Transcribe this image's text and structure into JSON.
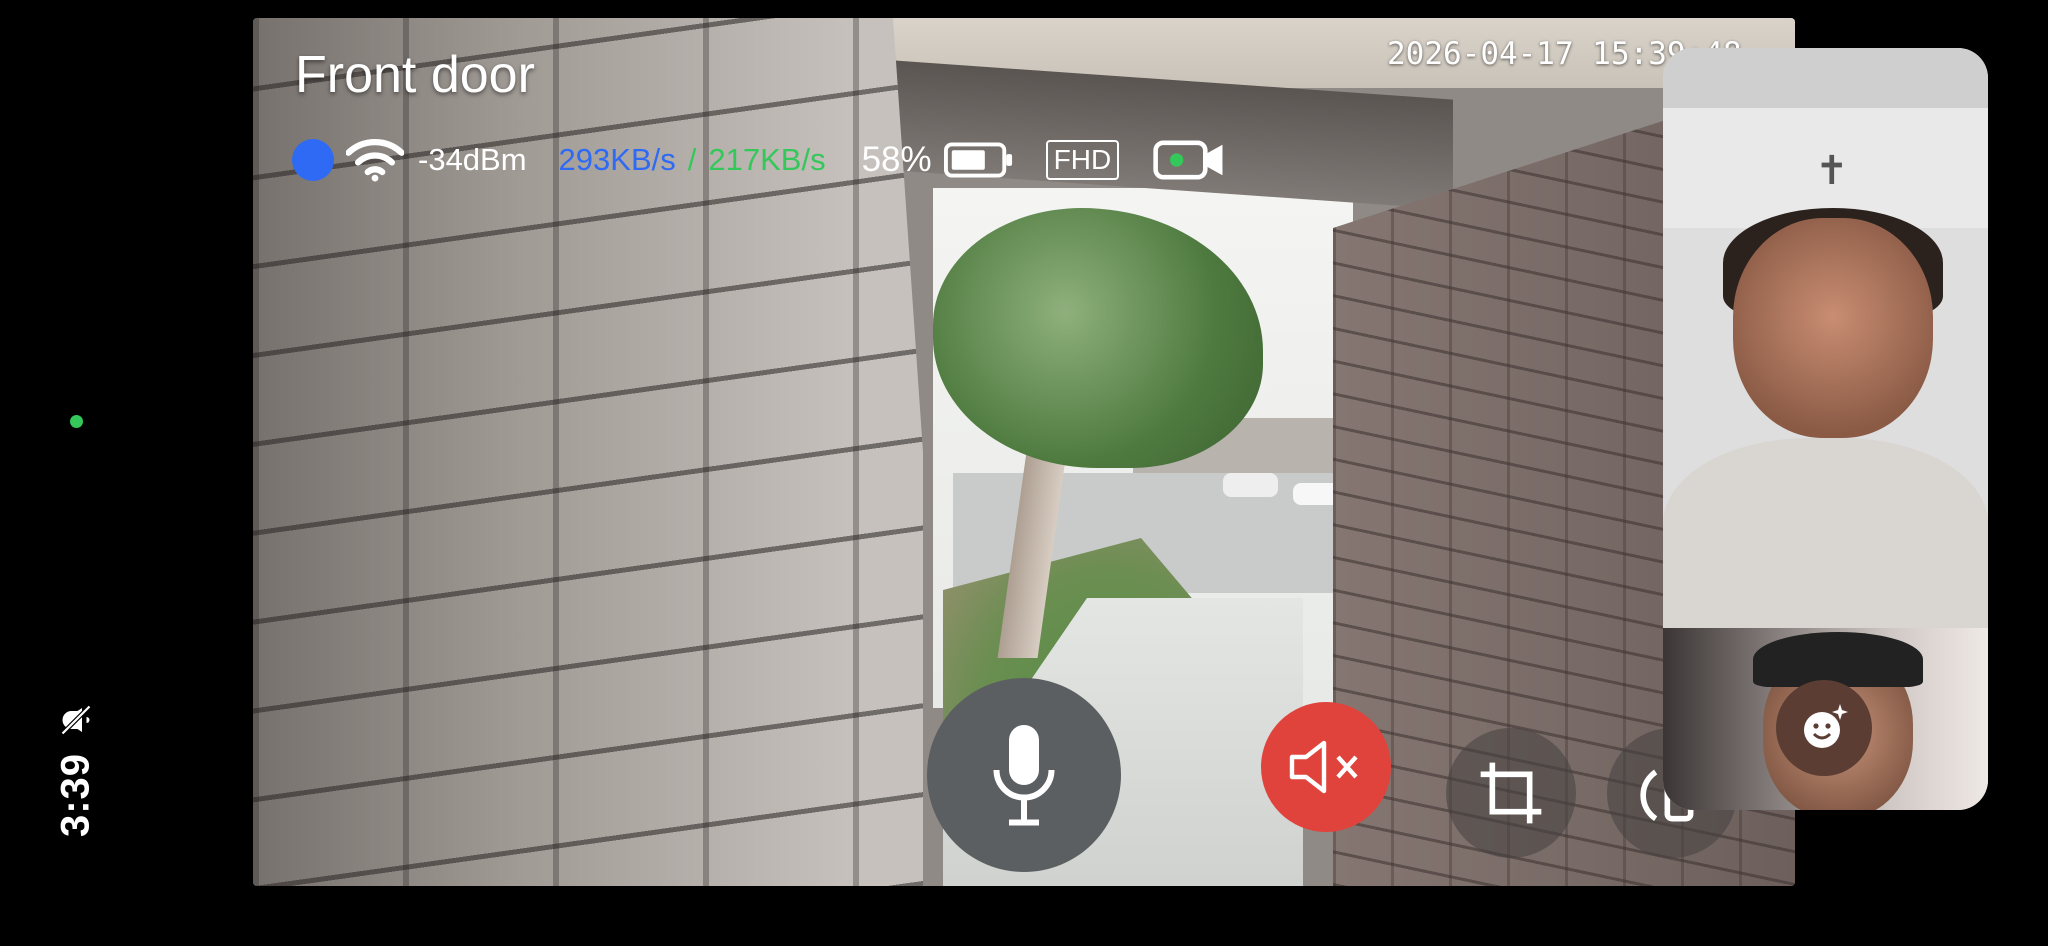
{
  "system": {
    "time": "3:39",
    "silent_icon": "bell-slash-icon",
    "indicator_color": "#34c759"
  },
  "camera": {
    "name": "Front door",
    "timestamp": "2026-04-17 15:39:48",
    "status": {
      "connection_dot_color": "#2f6af5",
      "wifi_icon": "wifi-icon",
      "signal": "-34dBm",
      "download_rate": "293KB/s",
      "separator": "/",
      "upload_rate": "217KB/s",
      "battery_percent": "58%",
      "battery_icon": "battery-icon",
      "quality": "FHD",
      "recording_icon": "video-camera-icon"
    }
  },
  "controls": {
    "talk": "microphone-icon",
    "speaker": "speaker-muted-icon",
    "crop": "crop-icon",
    "rotate": "rotate-icon"
  },
  "call": {
    "effects_icon": "smiley-sparkle-icon",
    "accent": "#e0433c"
  }
}
